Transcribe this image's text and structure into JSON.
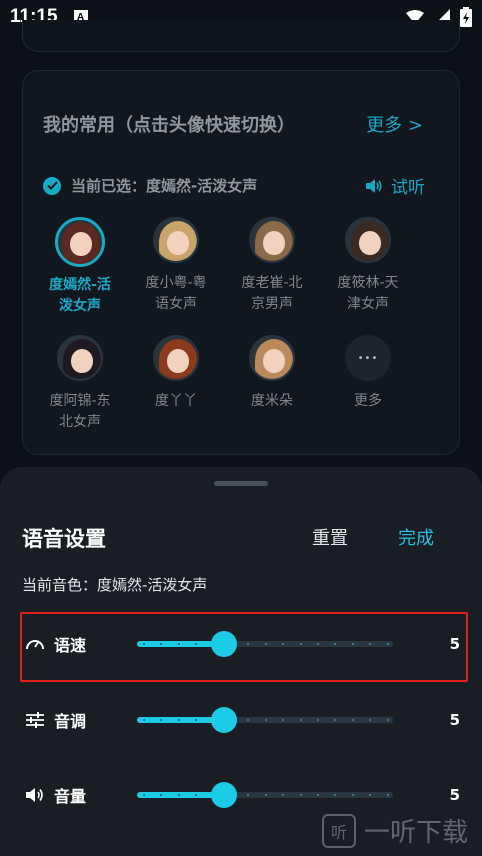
{
  "status": {
    "time": "11:15",
    "a_badge": "A"
  },
  "favorites": {
    "title": "我的常用（点击头像快速切换）",
    "more": "更多 >",
    "selected_prefix": "当前已选：",
    "selected_name": "度嫣然-活泼女声",
    "audition": "试听",
    "voices": [
      {
        "label": "度嫣然-活泼女声",
        "selected": true,
        "hair": "#5a2a22"
      },
      {
        "label": "度小粤-粤语女声",
        "selected": false,
        "hair": "#c9a56b"
      },
      {
        "label": "度老崔-北京男声",
        "selected": false,
        "hair": "#8a6a4a"
      },
      {
        "label": "度筱林-天津女声",
        "selected": false,
        "hair": "#3a2a24"
      },
      {
        "label": "度阿锦-东北女声",
        "selected": false,
        "hair": "#1e1a22"
      },
      {
        "label": "度丫丫",
        "selected": false,
        "hair": "#8c3a1c"
      },
      {
        "label": "度米朵",
        "selected": false,
        "hair": "#b98a5a"
      },
      {
        "label": "更多",
        "selected": false,
        "more": true
      }
    ]
  },
  "sheet": {
    "title": "语音设置",
    "reset": "重置",
    "done": "完成",
    "current_voice": "当前音色：度嫣然-活泼女声",
    "sliders": [
      {
        "label": "语速",
        "value": "5",
        "level": 0.34,
        "icon": "speedometer-icon"
      },
      {
        "label": "音调",
        "value": "5",
        "level": 0.34,
        "icon": "tune-sliders-icon"
      },
      {
        "label": "音量",
        "value": "5",
        "level": 0.34,
        "icon": "volume-icon"
      }
    ]
  },
  "watermark": {
    "text": "一听下载"
  },
  "colors": {
    "accent": "#1ccbe6",
    "highlight": "#e0221a"
  }
}
